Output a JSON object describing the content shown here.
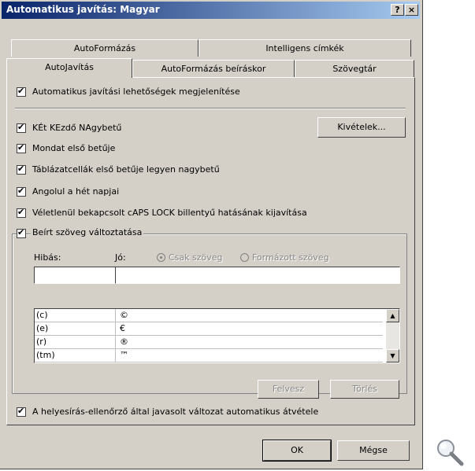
{
  "window": {
    "title": "Automatikus javítás: Magyar",
    "help_glyph": "?",
    "close_glyph": "×"
  },
  "tabs": {
    "back": [
      "AutoFormázás",
      "Intelligens címkék"
    ],
    "front": [
      "AutoJavítás",
      "AutoFormázás beíráskor",
      "Szövegtár"
    ],
    "active": "AutoJavítás"
  },
  "options": {
    "show_buttons": "Automatikus javítási lehetőségek megjelenítése",
    "two_initial_caps": "KÉt KEzdő NAgybetű",
    "sentence_cap": "Mondat első betűje",
    "table_cell_cap": "Táblázatcellák első betűje legyen nagybetű",
    "day_names": "Angolul a hét napjai",
    "caps_lock": "Véletlenül bekapcsolt cAPS LOCK billentyű hatásának kijavítása",
    "replace_text": "Beírt szöveg változtatása",
    "spell_checker": "A helyesírás-ellenőrző által javasolt változat automatikus átvétele"
  },
  "buttons": {
    "exceptions": "Kivételek...",
    "add": "Felvesz",
    "delete": "Törlés",
    "ok": "OK",
    "cancel": "Mégse"
  },
  "replace": {
    "wrong_label": "Hibás:",
    "right_label": "Jó:",
    "plain_text": "Csak szöveg",
    "formatted_text": "Formázott szöveg",
    "wrong_value": "",
    "right_value": "",
    "rows": [
      {
        "wrong": "(c)",
        "right": "©"
      },
      {
        "wrong": "(e)",
        "right": "€"
      },
      {
        "wrong": "(r)",
        "right": "®"
      },
      {
        "wrong": "(tm)",
        "right": "™"
      }
    ],
    "scroll_up": "▲",
    "scroll_down": "▼"
  },
  "icons": {
    "zoom": "magnifier-icon"
  },
  "colors": {
    "titlebar_start": "#0a246a",
    "titlebar_end": "#a6caf0",
    "face": "#d4d0c8"
  }
}
